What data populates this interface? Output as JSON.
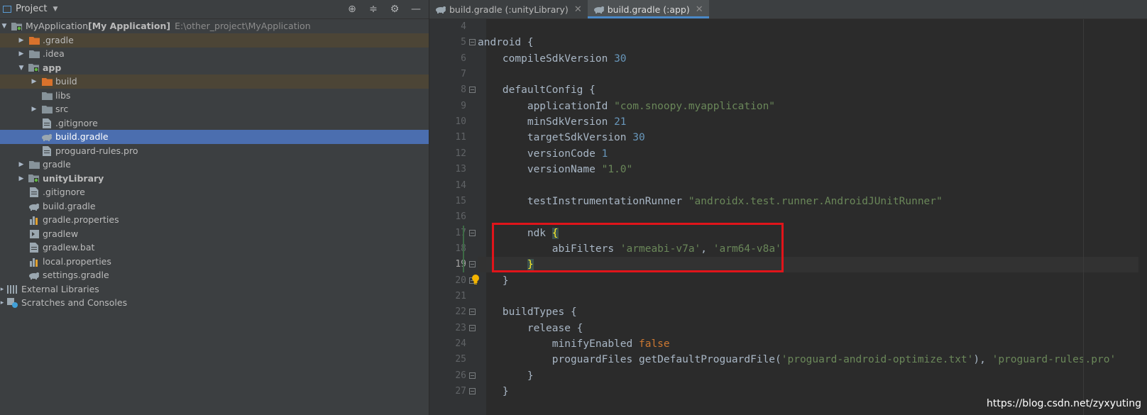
{
  "project_panel": {
    "title": "Project",
    "tree": [
      {
        "label": "MyApplication",
        "extra": "[My Application]",
        "path": "E:\\other_project\\MyApplication",
        "depth": 0,
        "arrow": "open",
        "icon": "module-folder",
        "bold": false,
        "state": "normal"
      },
      {
        "label": ".gradle",
        "depth": 1,
        "arrow": "closed",
        "icon": "orange-folder",
        "state": "highlight"
      },
      {
        "label": ".idea",
        "depth": 1,
        "arrow": "closed",
        "icon": "folder",
        "state": "normal"
      },
      {
        "label": "app",
        "depth": 1,
        "arrow": "open",
        "icon": "module-folder",
        "bold": true,
        "state": "normal"
      },
      {
        "label": "build",
        "depth": 2,
        "arrow": "closed",
        "icon": "orange-folder",
        "state": "highlight"
      },
      {
        "label": "libs",
        "depth": 2,
        "arrow": "none",
        "icon": "folder",
        "state": "normal"
      },
      {
        "label": "src",
        "depth": 2,
        "arrow": "closed",
        "icon": "folder",
        "state": "normal"
      },
      {
        "label": ".gitignore",
        "depth": 2,
        "arrow": "none",
        "icon": "file",
        "state": "normal"
      },
      {
        "label": "build.gradle",
        "depth": 2,
        "arrow": "none",
        "icon": "gradle",
        "state": "selected"
      },
      {
        "label": "proguard-rules.pro",
        "depth": 2,
        "arrow": "none",
        "icon": "file",
        "state": "normal"
      },
      {
        "label": "gradle",
        "depth": 1,
        "arrow": "closed",
        "icon": "folder",
        "state": "normal"
      },
      {
        "label": "unityLibrary",
        "depth": 1,
        "arrow": "closed",
        "icon": "module-folder",
        "bold": true,
        "state": "normal"
      },
      {
        "label": ".gitignore",
        "depth": 1,
        "arrow": "none",
        "icon": "file",
        "state": "normal"
      },
      {
        "label": "build.gradle",
        "depth": 1,
        "arrow": "none",
        "icon": "gradle",
        "state": "normal"
      },
      {
        "label": "gradle.properties",
        "depth": 1,
        "arrow": "none",
        "icon": "properties",
        "state": "normal"
      },
      {
        "label": "gradlew",
        "depth": 1,
        "arrow": "none",
        "icon": "exec",
        "state": "normal"
      },
      {
        "label": "gradlew.bat",
        "depth": 1,
        "arrow": "none",
        "icon": "file",
        "state": "normal"
      },
      {
        "label": "local.properties",
        "depth": 1,
        "arrow": "none",
        "icon": "properties",
        "state": "normal"
      },
      {
        "label": "settings.gradle",
        "depth": 1,
        "arrow": "none",
        "icon": "gradle",
        "state": "normal"
      },
      {
        "label": "External Libraries",
        "depth": 0,
        "arrow": "closed-small",
        "icon": "libraries",
        "state": "normal"
      },
      {
        "label": "Scratches and Consoles",
        "depth": 0,
        "arrow": "closed-small",
        "icon": "scratches",
        "state": "normal"
      }
    ]
  },
  "editor": {
    "tabs": [
      {
        "label": "build.gradle (:unityLibrary)",
        "active": false
      },
      {
        "label": "build.gradle (:app)",
        "active": true
      }
    ],
    "lines": [
      {
        "n": "4",
        "segs": [
          [
            "",
            ""
          ]
        ]
      },
      {
        "n": "5",
        "segs": [
          [
            "",
            "android {"
          ]
        ]
      },
      {
        "n": "6",
        "segs": [
          [
            "",
            "    compileSdkVersion "
          ],
          [
            "num",
            "30"
          ]
        ]
      },
      {
        "n": "7",
        "segs": [
          [
            "",
            ""
          ]
        ]
      },
      {
        "n": "8",
        "segs": [
          [
            "",
            "    defaultConfig {"
          ]
        ]
      },
      {
        "n": "9",
        "segs": [
          [
            "",
            "        applicationId "
          ],
          [
            "str",
            "\"com.snoopy.myapplication\""
          ]
        ]
      },
      {
        "n": "10",
        "segs": [
          [
            "",
            "        minSdkVersion "
          ],
          [
            "num",
            "21"
          ]
        ]
      },
      {
        "n": "11",
        "segs": [
          [
            "",
            "        targetSdkVersion "
          ],
          [
            "num",
            "30"
          ]
        ]
      },
      {
        "n": "12",
        "segs": [
          [
            "",
            "        versionCode "
          ],
          [
            "num",
            "1"
          ]
        ]
      },
      {
        "n": "13",
        "segs": [
          [
            "",
            "        versionName "
          ],
          [
            "str",
            "\"1.0\""
          ]
        ]
      },
      {
        "n": "14",
        "segs": [
          [
            "",
            ""
          ]
        ]
      },
      {
        "n": "15",
        "segs": [
          [
            "",
            "        testInstrumentationRunner "
          ],
          [
            "str",
            "\"androidx.test.runner.AndroidJUnitRunner\""
          ]
        ]
      },
      {
        "n": "16",
        "segs": [
          [
            "",
            ""
          ]
        ]
      },
      {
        "n": "17",
        "segs": [
          [
            "",
            "        ndk "
          ],
          [
            "brace",
            "{"
          ]
        ]
      },
      {
        "n": "18",
        "segs": [
          [
            "",
            "            abiFilters "
          ],
          [
            "str",
            "'armeabi-v7a'"
          ],
          [
            "",
            ", "
          ],
          [
            "str",
            "'arm64-v8a'"
          ]
        ]
      },
      {
        "n": "19",
        "segs": [
          [
            "",
            "        "
          ],
          [
            "brace",
            "}"
          ]
        ]
      },
      {
        "n": "20",
        "segs": [
          [
            "",
            "    }"
          ]
        ]
      },
      {
        "n": "21",
        "segs": [
          [
            "",
            ""
          ]
        ]
      },
      {
        "n": "22",
        "segs": [
          [
            "",
            "    buildTypes {"
          ]
        ]
      },
      {
        "n": "23",
        "segs": [
          [
            "",
            "        release {"
          ]
        ]
      },
      {
        "n": "24",
        "segs": [
          [
            "",
            "            minifyEnabled "
          ],
          [
            "kw",
            "false"
          ]
        ]
      },
      {
        "n": "25",
        "segs": [
          [
            "",
            "            proguardFiles getDefaultProguardFile("
          ],
          [
            "str",
            "'proguard-android-optimize.txt'"
          ],
          [
            "",
            "), "
          ],
          [
            "str",
            "'proguard-rules.pro'"
          ]
        ]
      },
      {
        "n": "26",
        "segs": [
          [
            "",
            "        }"
          ]
        ]
      },
      {
        "n": "27",
        "segs": [
          [
            "",
            "    }"
          ]
        ]
      }
    ],
    "current_line": "19",
    "fold_lines": [
      "5",
      "8",
      "17",
      "19",
      "20",
      "22",
      "23",
      "26",
      "27"
    ]
  },
  "watermark": "https://blog.csdn.net/zyxyuting"
}
